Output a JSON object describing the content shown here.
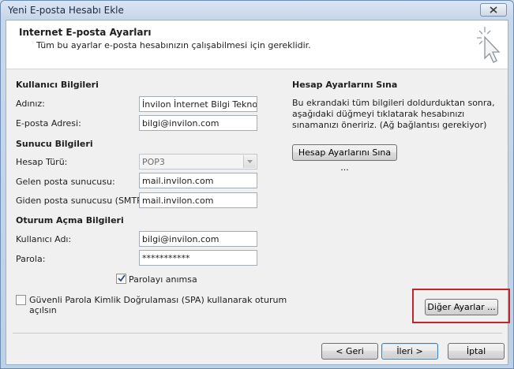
{
  "window": {
    "title": "Yeni E-posta Hesabı Ekle"
  },
  "header": {
    "title": "Internet E-posta Ayarları",
    "subtitle": "Tüm bu ayarlar e-posta hesabınızın çalışabilmesi için gereklidir."
  },
  "user_info": {
    "section": "Kullanıcı Bilgileri",
    "name_label": "Adınız:",
    "name_value": "İnvilon İnternet Bilgi Teknolojil",
    "email_label": "E-posta Adresi:",
    "email_value": "bilgi@invilon.com"
  },
  "server_info": {
    "section": "Sunucu Bilgileri",
    "account_type_label": "Hesap Türü:",
    "account_type_value": "POP3",
    "incoming_label": "Gelen posta sunucusu:",
    "incoming_value": "mail.invilon.com",
    "outgoing_label": "Giden posta sunucusu (SMTP):",
    "outgoing_value": "mail.invilon.com"
  },
  "logon_info": {
    "section": "Oturum Açma Bilgileri",
    "username_label": "Kullanıcı Adı:",
    "username_value": "bilgi@invilon.com",
    "password_label": "Parola:",
    "password_value": "***********",
    "remember_label": "Parolayı anımsa",
    "remember_checked": true,
    "spa_label_line1": "Güvenli Parola Kimlik Doğrulaması (SPA) kullanarak oturum",
    "spa_label_line2": "açılsın",
    "spa_checked": false
  },
  "test_settings": {
    "section": "Hesap Ayarlarını Sına",
    "description": "Bu ekrandaki tüm bilgileri doldurduktan sonra, aşağıdaki düğmeyi tıklatarak hesabınızı sınamanızı öneririz. (Ağ bağlantısı gerekiyor)",
    "test_button": "Hesap Ayarlarını Sına ..."
  },
  "more_settings_button": "Diğer Ayarlar ...",
  "footer": {
    "back": "< Geri",
    "next": "İleri >",
    "cancel": "İptal"
  },
  "colors": {
    "highlight": "#c0272d",
    "titlebar": "#c5d6ea"
  }
}
